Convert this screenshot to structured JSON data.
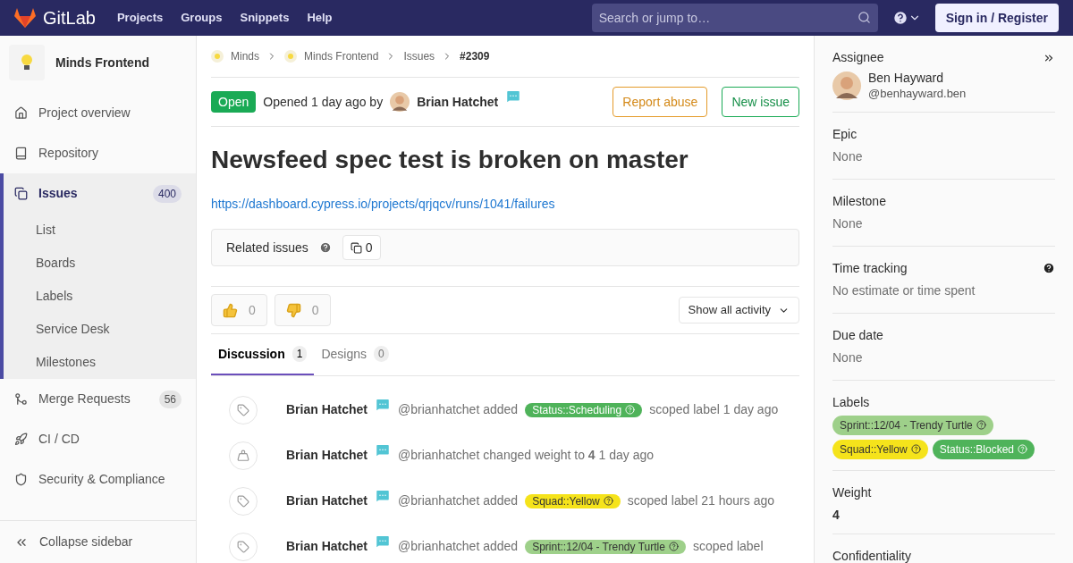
{
  "header": {
    "brand": "GitLab",
    "nav": [
      "Projects",
      "Groups",
      "Snippets",
      "Help"
    ],
    "search": {
      "placeholder": "Search or jump to…"
    },
    "sign_in": "Sign in / Register"
  },
  "sidebar": {
    "project": "Minds Frontend",
    "items": [
      {
        "label": "Project overview",
        "selected": false
      },
      {
        "label": "Repository",
        "selected": false
      },
      {
        "label": "Issues",
        "selected": true,
        "count": "400",
        "children": [
          {
            "label": "List"
          },
          {
            "label": "Boards"
          },
          {
            "label": "Labels"
          },
          {
            "label": "Service Desk"
          },
          {
            "label": "Milestones"
          }
        ]
      },
      {
        "label": "Merge Requests",
        "selected": false,
        "count": "56"
      },
      {
        "label": "CI / CD",
        "selected": false
      },
      {
        "label": "Security & Compliance",
        "selected": false
      }
    ],
    "collapse": "Collapse sidebar"
  },
  "breadcrumbs": [
    "Minds",
    "Minds Frontend",
    "Issues",
    "#2309"
  ],
  "issue": {
    "status": "Open",
    "opened": "Opened 1 day ago by",
    "author": "Brian Hatchet",
    "report": "Report abuse",
    "new": "New issue",
    "title": "Newsfeed spec test is broken on master",
    "link": "https://dashboard.cypress.io/projects/qrjqcv/runs/1041/failures",
    "related": {
      "label": "Related issues",
      "count": "0"
    },
    "thumbs_up": "0",
    "thumbs_down": "0",
    "filter": "Show all activity"
  },
  "tabs": [
    {
      "label": "Discussion",
      "count": "1",
      "selected": true
    },
    {
      "label": "Designs",
      "count": "0",
      "selected": false
    }
  ],
  "activity": [
    {
      "kind": "label",
      "author": "Brian Hatchet",
      "handle": "@brianhatchet added",
      "label": {
        "text": "Status::Scheduling",
        "color": "#4fb35a"
      },
      "after": "scoped label 1 day ago"
    },
    {
      "kind": "weight",
      "author": "Brian Hatchet",
      "handle": "@brianhatchet",
      "text": "changed weight to **4** 1 day ago"
    },
    {
      "kind": "label",
      "author": "Brian Hatchet",
      "handle": "@brianhatchet added",
      "label": {
        "text": "Squad::Yellow",
        "color": "#f5e31b"
      },
      "after": "scoped label 21 hours ago"
    },
    {
      "kind": "label",
      "author": "Brian Hatchet",
      "handle": "@brianhatchet added",
      "label": {
        "text": "Sprint::12/04 - Trendy Turtle",
        "color": "#9ed08a"
      },
      "after": "scoped label"
    }
  ],
  "right": {
    "assignee": {
      "title": "Assignee",
      "name": "Ben Hayward",
      "handle": "@benhayward.ben"
    },
    "sections": [
      {
        "title": "Epic",
        "value": "None"
      },
      {
        "title": "Milestone",
        "value": "None"
      },
      {
        "title": "Time tracking",
        "value": "No estimate or time spent",
        "help": true
      },
      {
        "title": "Due date",
        "value": "None"
      }
    ],
    "labels": {
      "title": "Labels",
      "items": [
        {
          "text": "Sprint::12/04 - Trendy Turtle",
          "color": "#9ed08a"
        },
        {
          "text": "Squad::Yellow",
          "color": "#f5e31b"
        },
        {
          "text": "Status::Blocked",
          "color": "#4fb35a"
        }
      ]
    },
    "weight": {
      "title": "Weight",
      "value": "4"
    },
    "confidentiality": {
      "title": "Confidentiality"
    }
  }
}
